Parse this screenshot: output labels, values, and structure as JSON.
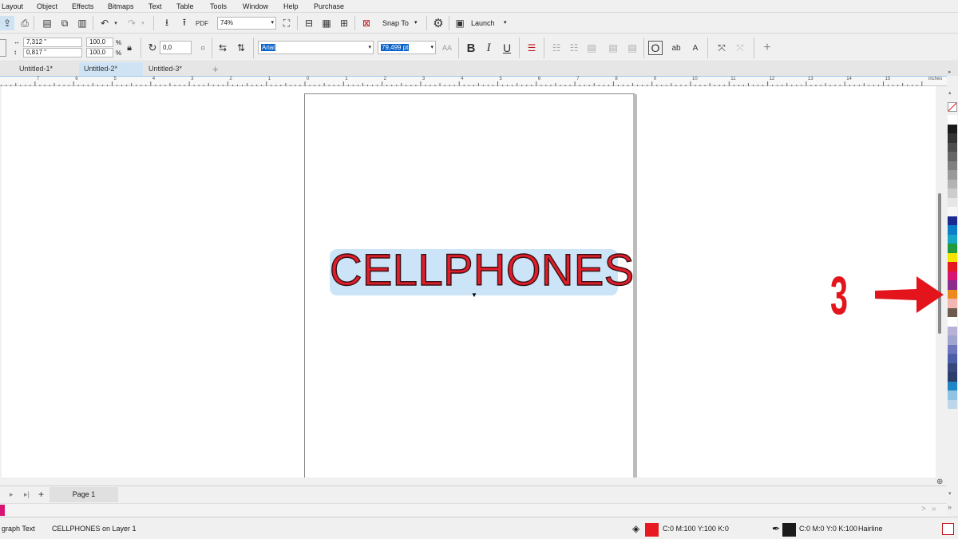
{
  "menu": [
    "Layout",
    "Object",
    "Effects",
    "Bitmaps",
    "Text",
    "Table",
    "Tools",
    "Window",
    "Help",
    "Purchase"
  ],
  "toolbar": {
    "zoom_value": "74%",
    "snap_label": "Snap To",
    "launch_label": "Launch",
    "pdf_label": "PDF"
  },
  "properties": {
    "width": "7,312 \"",
    "height": "0,817 \"",
    "scale_x": "100,0",
    "scale_y": "100,0",
    "percent_x": "%",
    "percent_y": "%",
    "rotation": "0,0",
    "font_name": "Arial",
    "font_size": "79,499 pt",
    "bold_label": "B",
    "italic_label": "I",
    "underline_label": "U"
  },
  "tabs": [
    {
      "label": "Untitled-1*",
      "active": false
    },
    {
      "label": "Untitled-2*",
      "active": true
    },
    {
      "label": "Untitled-3*",
      "active": false
    }
  ],
  "ruler": {
    "ticks": [
      "7",
      "6",
      "5",
      "4",
      "3",
      "2",
      "1",
      "0",
      "1",
      "2",
      "3",
      "4",
      "5",
      "6",
      "7",
      "8",
      "9",
      "10",
      "11",
      "12",
      "13",
      "14",
      "15"
    ],
    "unit": "inches"
  },
  "canvas": {
    "text_content": "CELLPHONES"
  },
  "annotation": {
    "number": "3",
    "color": "#e3141b"
  },
  "palette": {
    "colors": [
      "#ffffff",
      "#1a1a1a",
      "#333333",
      "#4d4d4d",
      "#666666",
      "#808080",
      "#999999",
      "#b3b3b3",
      "#cccccc",
      "#e6e6e6",
      "#f7f7f7",
      "#1b2a8f",
      "#0b7ec9",
      "#15a6c8",
      "#1f9a3c",
      "#f2e500",
      "#e5191f",
      "#d81472",
      "#8b2c8e",
      "#ec8a1d",
      "#f4b6b0",
      "#6e5a4e",
      "#ffffff",
      "#b9b2d8",
      "#9fa5cf",
      "#6c77bd",
      "#4b5fa8",
      "#35497e",
      "#2c3f6c",
      "#1f86c7",
      "#8fc3e5",
      "#bcd7ea"
    ]
  },
  "page_nav": {
    "page_label": "Page 1"
  },
  "status": {
    "object_type": "graph Text",
    "object_info": "CELLPHONES on Layer 1",
    "fill_cmyk": "C:0 M:100 Y:100 K:0",
    "fill_color": "#e5191f",
    "outline_cmyk": "C:0 M:0 Y:0 K:100",
    "outline_weight": "Hairline",
    "outline_color": "#1a1a1a"
  }
}
